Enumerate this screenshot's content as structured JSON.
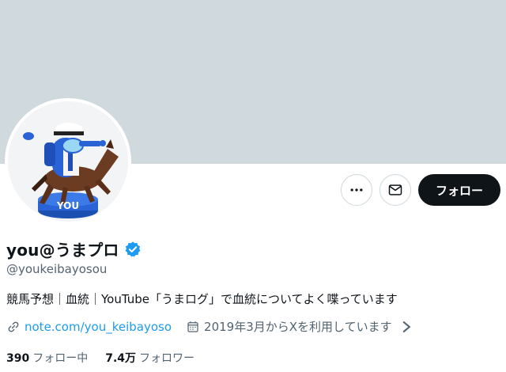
{
  "profile": {
    "display_name": "you@うまプロ",
    "handle": "@youkeibayosou",
    "bio": "競馬予想｜血統｜YouTube「うまログ」で血統についてよく喋っています",
    "website": "note.com/you_keibayoso",
    "joined": "2019年3月からXを利用しています",
    "avatar_label": "YOU"
  },
  "actions": {
    "more_icon": "more-dots-icon",
    "message_icon": "envelope-icon",
    "follow_label": "フォロー"
  },
  "stats": {
    "following_count": "390",
    "following_label": "フォロー中",
    "followers_count": "7.4万",
    "followers_label": "フォロワー"
  },
  "colors": {
    "banner": "#cfd9de",
    "accent": "#1d9bf0",
    "follow_button": "#0f1419",
    "secondary_text": "#536471"
  }
}
